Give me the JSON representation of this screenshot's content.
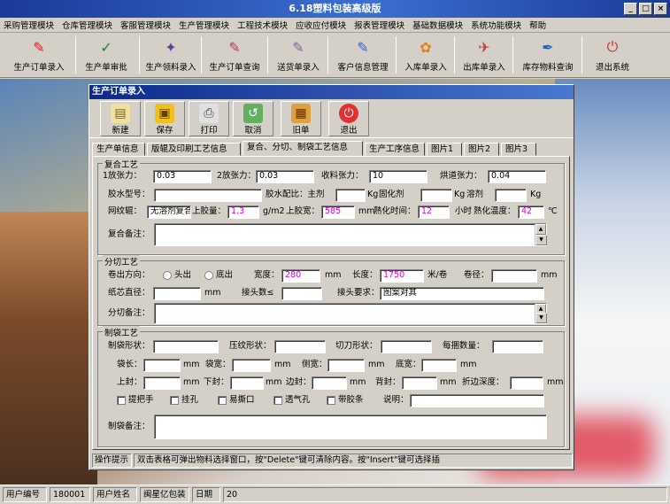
{
  "window": {
    "title": "6.18塑料包装高级版",
    "min": "_",
    "max": "□",
    "close": "×"
  },
  "menu": [
    "采购管理模块",
    "仓库管理模块",
    "客服管理模块",
    "生产管理模块",
    "工程技术模块",
    "应收应付模块",
    "报表管理模块",
    "基础数据模块",
    "系统功能模块",
    "帮助"
  ],
  "toolbar": [
    {
      "label": "生产订单录入",
      "icon": "pdf-document-icon",
      "color": "#d02020"
    },
    {
      "label": "生产单审批",
      "icon": "approve-icon",
      "color": "#208040"
    },
    {
      "label": "生产领料录入",
      "icon": "material-icon",
      "color": "#6040a0"
    },
    {
      "label": "生产订单查询",
      "icon": "query-icon",
      "color": "#c03060"
    },
    {
      "label": "送货单录入",
      "icon": "delivery-icon",
      "color": "#8060b0"
    },
    {
      "label": "客户信息管理",
      "icon": "customer-icon",
      "color": "#4060c0"
    },
    {
      "label": "入库单录入",
      "icon": "inbound-icon",
      "color": "#e08020"
    },
    {
      "label": "出库单录入",
      "icon": "outbound-icon",
      "color": "#c04040"
    },
    {
      "label": "库存物料查询",
      "icon": "feather-icon",
      "color": "#2060c0"
    },
    {
      "label": "退出系统",
      "icon": "exit-icon",
      "color": "#d03030"
    }
  ],
  "form": {
    "title": "生产订单录入",
    "buttons": [
      "新建",
      "保存",
      "打印",
      "取消",
      "旧单",
      "退出"
    ],
    "tabs": [
      "生产单信息",
      "版辊及印刷工艺信息",
      "复合、分切、制袋工艺信息",
      "生产工序信息",
      "图片1",
      "图片2",
      "图片3"
    ],
    "active_tab": 2,
    "composite": {
      "legend": "复合工艺",
      "tension1_label": "1放张力：",
      "tension1": "0.03",
      "tension2_label": "2放张力：",
      "tension2": "0.03",
      "rewind_label": "收料张力：",
      "rewind": "10",
      "oven_label": "烘道张力：",
      "oven": "0.04",
      "glue_type_label": "胶水型号：",
      "glue_type": "",
      "glue_ratio_label": "胶水配比：主剂",
      "kg1": "Kg",
      "curing_label": "固化剂",
      "kg2": "Kg",
      "solvent_label": "溶剂",
      "kg3": "Kg",
      "roller_label": "网纹辊：",
      "roller": "无溶剂复合",
      "glue_amount_label": "上胶量：",
      "glue_amount": "1.3",
      "glue_unit": "g/m2",
      "glue_width_label": "上胶宽：",
      "glue_width": "585",
      "mm1": "mm",
      "cure_time_label": "熟化时间：",
      "cure_time": "12",
      "hour": "小时",
      "cure_temp_label": "熟化温度：",
      "cure_temp": "42",
      "celsius": "℃",
      "note_label": "复合备注："
    },
    "slitting": {
      "legend": "分切工艺",
      "direction_label": "卷出方向：",
      "head": "头出",
      "tail": "底出",
      "width_label": "宽度：",
      "width": "280",
      "mm_w": "mm",
      "length_label": "长度：",
      "length": "1750",
      "length_unit": "米/卷",
      "diameter_label": "卷径：",
      "mm_d": "mm",
      "core_label": "纸芯直径：",
      "mm_c": "mm",
      "joints_label": "接头数≤",
      "joint_req_label": "接头要求：",
      "joint_req": "图案对其",
      "note_label": "分切备注："
    },
    "bagmaking": {
      "legend": "制袋工艺",
      "bag_shape_label": "制袋形状：",
      "press_label": "压纹形状：",
      "knife_label": "切刀形状：",
      "bundle_label": "每捆数量：",
      "bag_len_label": "袋长：",
      "bag_wid_label": "袋宽：",
      "side_wid_label": "侧宽：",
      "bottom_wid_label": "底宽：",
      "top_seal_label": "上封：",
      "bottom_seal_label": "下封：",
      "side_seal_label": "边封：",
      "back_seal_label": "背封：",
      "fold_label": "折边深度：",
      "mm": "mm",
      "checks": [
        "提把手",
        "挂孔",
        "易撕口",
        "透气孔",
        "带胶条"
      ],
      "desc_label": "说明：",
      "note_label": "制袋备注："
    },
    "hint_label": "操作提示",
    "hint": "双击表格可弹出物料选择窗口，按\"Delete\"键可清除内容。按\"Insert\"键可选择插"
  },
  "status": {
    "user_id_label": "用户编号",
    "user_id": "180001",
    "user_name_label": "用户姓名",
    "user_name": "闽星亿包装",
    "date_label": "日期",
    "date": "20"
  }
}
